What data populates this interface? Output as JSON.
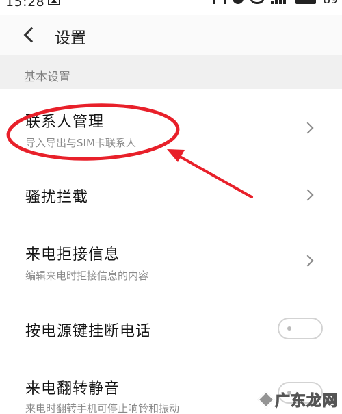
{
  "status_bar": {
    "time": "15:28",
    "battery": "89"
  },
  "header": {
    "title": "设置"
  },
  "section": {
    "title": "基本设置"
  },
  "rows": [
    {
      "title": "联系人管理",
      "subtitle": "导入导出与SIM卡联系人"
    },
    {
      "title": "骚扰拦截"
    },
    {
      "title": "来电拒接信息",
      "subtitle": "编辑来电时拒接信息的内容"
    },
    {
      "title": "按电源键挂断电话"
    },
    {
      "title": "来电翻转静音",
      "subtitle": "来电时翻转手机可停止响铃和振动"
    }
  ],
  "annotation": {
    "color": "#e8202a"
  },
  "watermark": {
    "text": "广东龙网"
  }
}
